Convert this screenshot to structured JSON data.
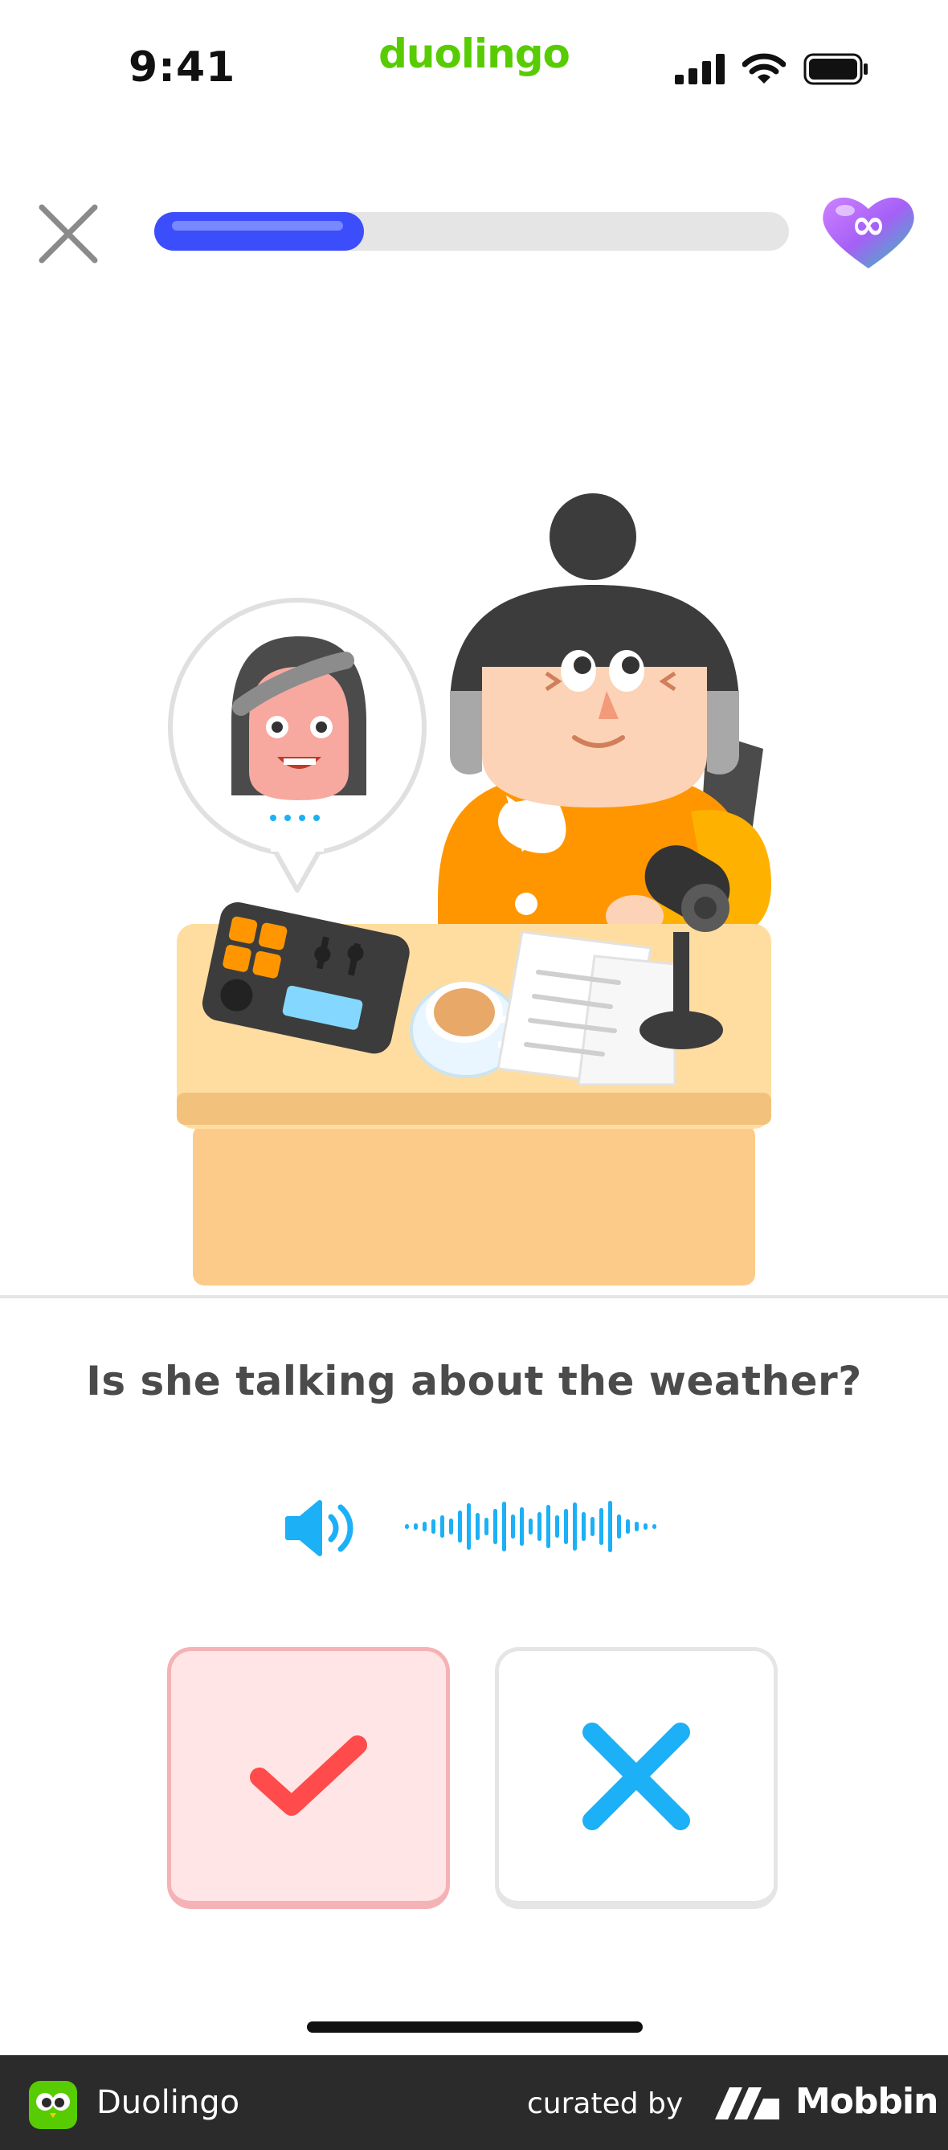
{
  "status_bar": {
    "time": "9:41",
    "brand": "duolingo",
    "icons": [
      "signal-icon",
      "wifi-icon",
      "battery-icon"
    ]
  },
  "lesson": {
    "progress": 0.33,
    "hearts": "∞",
    "close_icon": "close-icon"
  },
  "question": {
    "text": "Is she talking about the weather?"
  },
  "audio": {
    "speaker_icon": "speaker-icon",
    "waveform_icon": "waveform-icon"
  },
  "answers": {
    "yes": {
      "icon": "checkmark-icon",
      "selected": true
    },
    "no": {
      "icon": "x-icon",
      "selected": false
    }
  },
  "footer": {
    "app_name": "Duolingo",
    "curated_by": "curated by",
    "brand": "Mobbin"
  },
  "colors": {
    "brand_green": "#58cc02",
    "progress_blue": "#3c4dfb",
    "check_red": "#ff4b4b",
    "cross_blue": "#1cb0f6",
    "selected_bg": "#ffe5e5"
  }
}
